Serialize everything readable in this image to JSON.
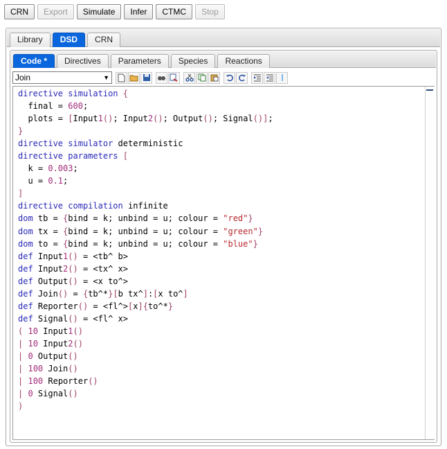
{
  "toolbar": {
    "buttons": [
      {
        "label": "CRN",
        "enabled": true
      },
      {
        "label": "Export",
        "enabled": false
      },
      {
        "label": "Simulate",
        "enabled": true
      },
      {
        "label": "Infer",
        "enabled": true
      },
      {
        "label": "CTMC",
        "enabled": true
      },
      {
        "label": "Stop",
        "enabled": false
      }
    ]
  },
  "main_tabs": [
    {
      "label": "Library",
      "active": false
    },
    {
      "label": "DSD",
      "active": true
    },
    {
      "label": "CRN",
      "active": false
    }
  ],
  "sub_tabs": [
    {
      "label": "Code *",
      "active": true
    },
    {
      "label": "Directives",
      "active": false
    },
    {
      "label": "Parameters",
      "active": false
    },
    {
      "label": "Species",
      "active": false
    },
    {
      "label": "Reactions",
      "active": false
    }
  ],
  "editor": {
    "model_select": "Join",
    "icons": [
      "new-file-icon",
      "open-folder-icon",
      "save-icon",
      "find-icon",
      "replace-icon",
      "cut-icon",
      "copy-icon",
      "paste-icon",
      "undo-icon",
      "redo-icon",
      "indent-icon",
      "outdent-icon",
      "comment-icon"
    ]
  },
  "code_lines": [
    "directive simulation {",
    "  final = 600;",
    "  plots = [Input1(); Input2(); Output(); Signal()];",
    "}",
    "directive simulator deterministic",
    "directive parameters [",
    "  k = 0.003;",
    "  u = 0.1;",
    "]",
    "directive compilation infinite",
    "dom tb = {bind = k; unbind = u; colour = \"red\"}",
    "dom tx = {bind = k; unbind = u; colour = \"green\"}",
    "dom to = {bind = k; unbind = u; colour = \"blue\"}",
    "def Input1() = <tb^ b>",
    "def Input2() = <tx^ x>",
    "def Output() = <x to^>",
    "def Join() = {tb^*}[b tx^]:[x to^]",
    "def Reporter() = <fl^>[x]{to^*}",
    "def Signal() = <fl^ x>",
    "( 10 Input1()",
    "| 10 Input2()",
    "| 0 Output()",
    "| 100 Join()",
    "| 100 Reporter()",
    "| 0 Signal()",
    ")"
  ]
}
